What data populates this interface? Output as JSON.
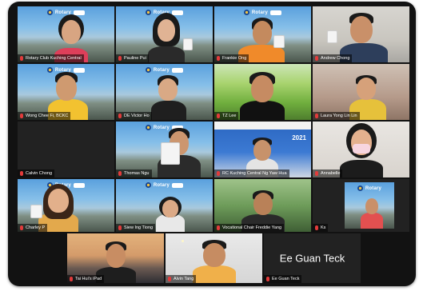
{
  "participants": [
    {
      "name": "Rotary Club Kuching Central",
      "banner": "Rotary"
    },
    {
      "name": "Pauline Pui",
      "banner": "Rotary"
    },
    {
      "name": "Frankie Ong",
      "banner": "Rotary"
    },
    {
      "name": "Andrew Chong"
    },
    {
      "name": "Wong Chee Fi, BCKC",
      "banner": "Rotary"
    },
    {
      "name": "DE Victor Ho",
      "banner": "Rotary"
    },
    {
      "name": "TZ Lee"
    },
    {
      "name": "Laura Yong Lin Lin"
    },
    {
      "name": "Calvin Chong"
    },
    {
      "name": "Thomas Ngu",
      "banner": "Rotary"
    },
    {
      "name": "RC Kuching Central Ng Yaw Hua",
      "banner": "2021"
    },
    {
      "name": "Annabelle"
    },
    {
      "name": "Charley P",
      "banner": "Rotary"
    },
    {
      "name": "Siew Ing Tiong",
      "banner": "Rotary"
    },
    {
      "name": "Vocational Chair Freddie Yang"
    },
    {
      "name": "Ks",
      "banner": "Rotary"
    },
    {
      "name": "Tai Hui's iPad"
    },
    {
      "name": "Alvin Tang"
    },
    {
      "name": "Ee Guan Teck",
      "big_name": "Ee Guan Teck"
    }
  ],
  "colors": {
    "gallery_background": "#121212",
    "label_text": "#ffffff",
    "mic_muted": "#e23b3b",
    "rotary_gold": "#f4c542",
    "rotary_blue": "#17458f"
  }
}
